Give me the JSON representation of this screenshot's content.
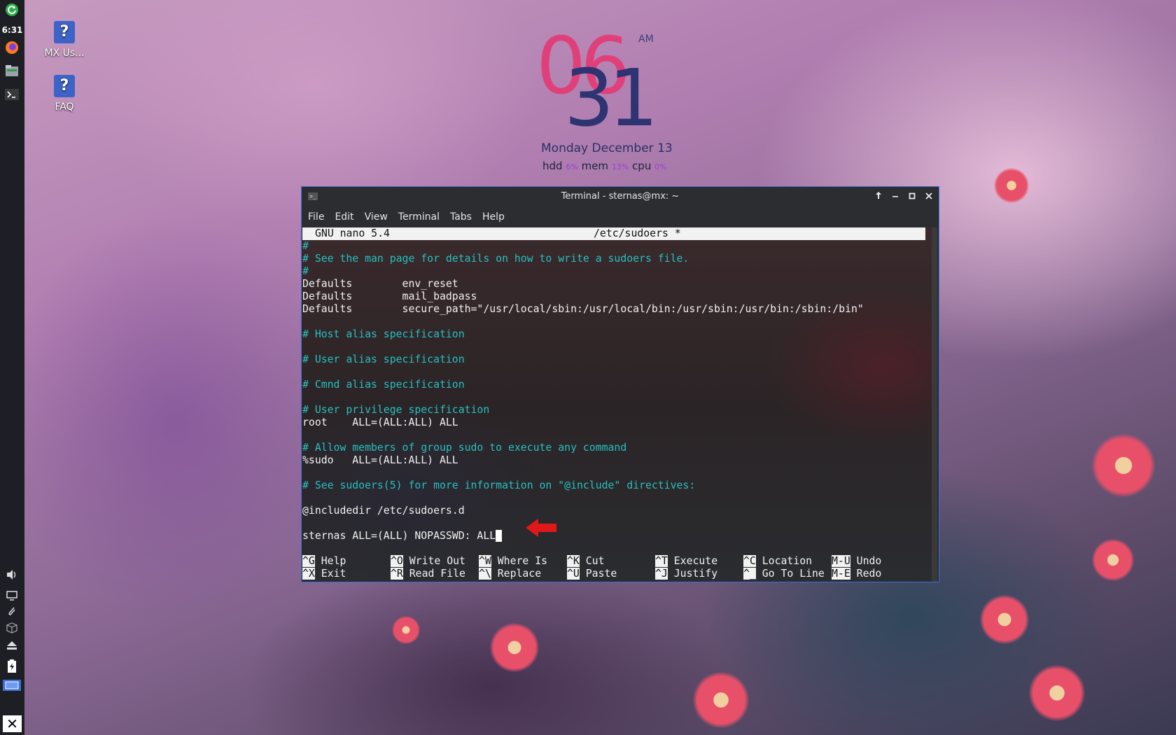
{
  "panel": {
    "clock": "6:31"
  },
  "desktop": {
    "icons": [
      {
        "label": "MX Us...",
        "glyph": "?"
      },
      {
        "label": "FAQ",
        "glyph": "?"
      }
    ]
  },
  "conky": {
    "hour": "06",
    "minute": "31",
    "ampm": "AM",
    "date": "Monday   December 13",
    "hdd_label": "hdd",
    "hdd_value": "6%",
    "mem_label": "mem",
    "mem_value": "13%",
    "cpu_label": "cpu",
    "cpu_value": "0%"
  },
  "terminal": {
    "title": "Terminal - sternas@mx: ~",
    "menu": [
      "File",
      "Edit",
      "View",
      "Terminal",
      "Tabs",
      "Help"
    ],
    "nano": {
      "version": "GNU nano 5.4",
      "filename": "/etc/sudoers *",
      "lines": [
        "#",
        "# See the man page for details on how to write a sudoers file.",
        "#",
        "Defaults        env_reset",
        "Defaults        mail_badpass",
        "Defaults        secure_path=\"/usr/local/sbin:/usr/local/bin:/usr/sbin:/usr/bin:/sbin:/bin\"",
        "",
        "# Host alias specification",
        "",
        "# User alias specification",
        "",
        "# Cmnd alias specification",
        "",
        "# User privilege specification",
        "root    ALL=(ALL:ALL) ALL",
        "",
        "# Allow members of group sudo to execute any command",
        "%sudo   ALL=(ALL:ALL) ALL",
        "",
        "# See sudoers(5) for more information on \"@include\" directives:",
        "",
        "@includedir /etc/sudoers.d",
        "",
        "sternas ALL=(ALL) NOPASSWD: ALL"
      ],
      "shortcuts_row1": [
        {
          "key": "^G",
          "label": "Help"
        },
        {
          "key": "^O",
          "label": "Write Out"
        },
        {
          "key": "^W",
          "label": "Where Is"
        },
        {
          "key": "^K",
          "label": "Cut"
        },
        {
          "key": "^T",
          "label": "Execute"
        },
        {
          "key": "^C",
          "label": "Location"
        },
        {
          "key": "M-U",
          "label": "Undo"
        }
      ],
      "shortcuts_row2": [
        {
          "key": "^X",
          "label": "Exit"
        },
        {
          "key": "^R",
          "label": "Read File"
        },
        {
          "key": "^\\",
          "label": "Replace"
        },
        {
          "key": "^U",
          "label": "Paste"
        },
        {
          "key": "^J",
          "label": "Justify"
        },
        {
          "key": "^_",
          "label": "Go To Line"
        },
        {
          "key": "M-E",
          "label": "Redo"
        }
      ]
    }
  },
  "colors": {
    "comment": "#27c0c0",
    "arrow": "#e01818",
    "window_border": "#3b6fd8"
  }
}
